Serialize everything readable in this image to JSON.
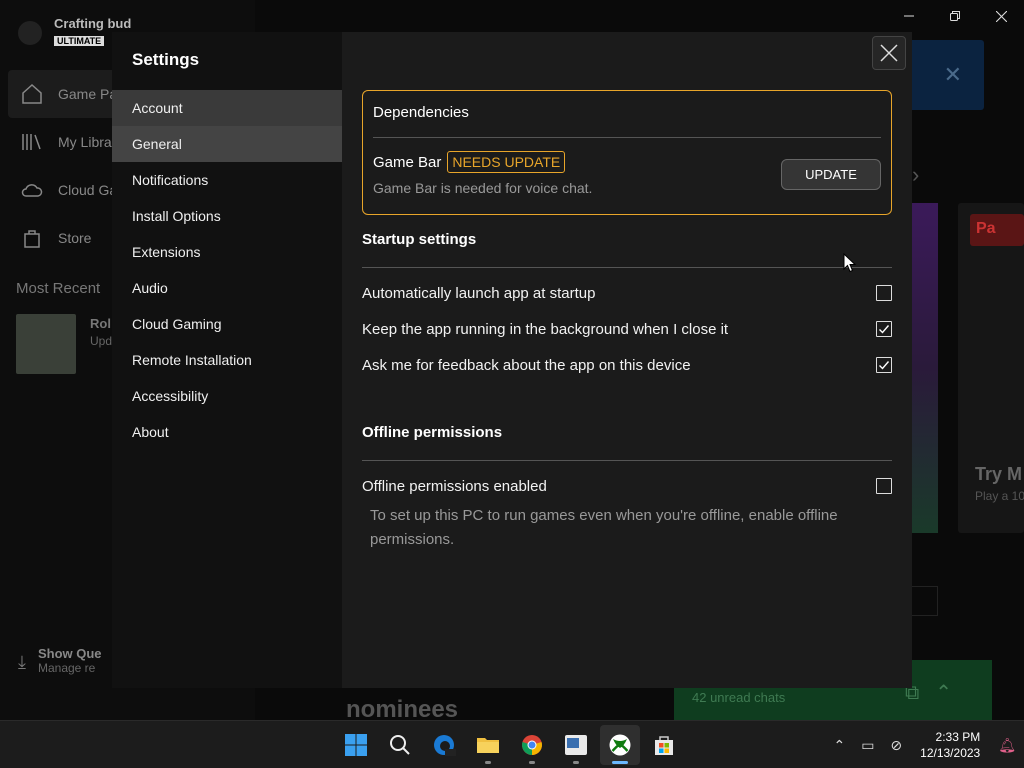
{
  "background": {
    "profile_name": "Crafting bud",
    "profile_badge": "ULTIMATE",
    "nav": [
      "Game Pa",
      "My Libra",
      "Cloud Ga",
      "Store"
    ],
    "recent_title": "Most Recent",
    "recent_item_title": "Rol",
    "recent_item_sub": "Upd",
    "queue_title": "Show Que",
    "queue_sub": "Manage re",
    "promo_badge": "Pa",
    "promo_title": "Try M",
    "promo_sub": "Play a 10",
    "chats": "42 unread chats",
    "nominees": "nominees"
  },
  "settings": {
    "title": "Settings",
    "nav": [
      {
        "label": "Account"
      },
      {
        "label": "General"
      },
      {
        "label": "Notifications"
      },
      {
        "label": "Install Options"
      },
      {
        "label": "Extensions"
      },
      {
        "label": "Audio"
      },
      {
        "label": "Cloud Gaming"
      },
      {
        "label": "Remote Installation"
      },
      {
        "label": "Accessibility"
      },
      {
        "label": "About"
      }
    ],
    "dependencies": {
      "title": "Dependencies",
      "item": "Game Bar",
      "badge": "NEEDS UPDATE",
      "description": "Game Bar is needed for voice chat.",
      "button": "UPDATE"
    },
    "startup": {
      "title": "Startup settings",
      "rows": [
        {
          "label": "Automatically launch app at startup",
          "checked": false
        },
        {
          "label": "Keep the app running in the background when I close it",
          "checked": true
        },
        {
          "label": "Ask me for feedback about the app on this device",
          "checked": true
        }
      ]
    },
    "offline": {
      "title": "Offline permissions",
      "row": {
        "label": "Offline permissions enabled",
        "checked": false
      },
      "description": "To set up this PC to run games even when you're offline, enable offline permissions."
    }
  },
  "taskbar": {
    "time": "2:33 PM",
    "date": "12/13/2023",
    "accent": "#6cb8ff"
  },
  "colors": {
    "warning": "#e8a52a"
  }
}
